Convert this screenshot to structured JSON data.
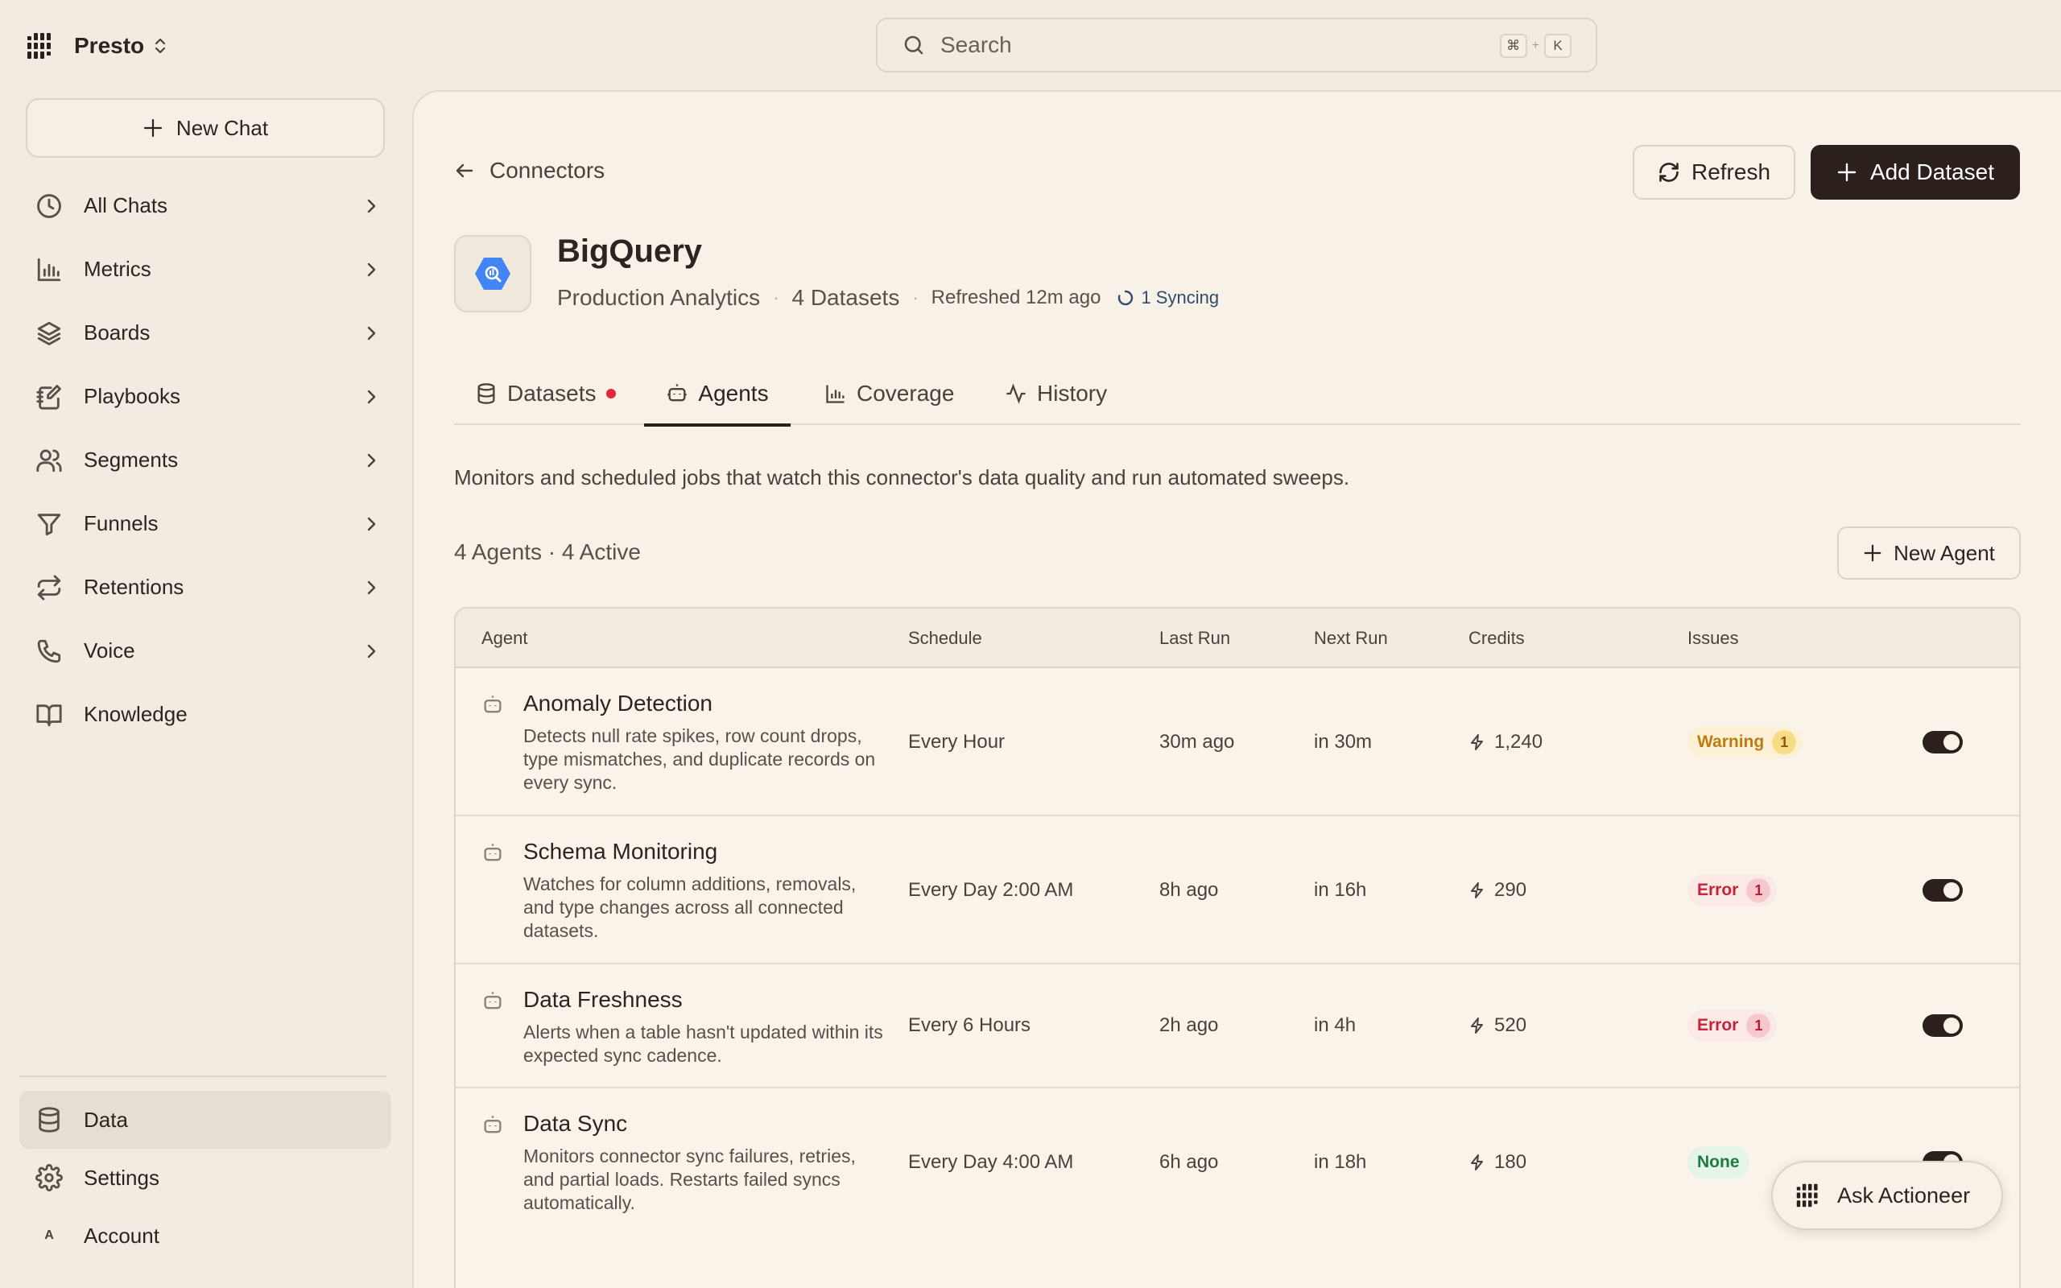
{
  "app": {
    "name": "Presto"
  },
  "sidebar": {
    "new_chat": "New Chat",
    "items": [
      {
        "label": "All Chats",
        "icon": "clock-icon"
      },
      {
        "label": "Metrics",
        "icon": "bar-chart-icon"
      },
      {
        "label": "Boards",
        "icon": "layers-icon"
      },
      {
        "label": "Playbooks",
        "icon": "notebook-pen-icon"
      },
      {
        "label": "Segments",
        "icon": "users-icon"
      },
      {
        "label": "Funnels",
        "icon": "funnel-icon"
      },
      {
        "label": "Retentions",
        "icon": "repeat-icon"
      },
      {
        "label": "Voice",
        "icon": "phone-icon"
      },
      {
        "label": "Knowledge",
        "icon": "book-open-icon"
      }
    ],
    "bottom": [
      {
        "label": "Data",
        "icon": "database-icon",
        "active": true
      },
      {
        "label": "Settings",
        "icon": "gear-icon"
      },
      {
        "label": "Account",
        "avatar": "A"
      }
    ]
  },
  "search": {
    "placeholder": "Search",
    "shortcut_cmd": "⌘",
    "shortcut_plus": "+",
    "shortcut_key": "K"
  },
  "header": {
    "back_label": "Connectors",
    "refresh_label": "Refresh",
    "add_label": "Add Dataset"
  },
  "connector": {
    "title": "BigQuery",
    "project": "Production Analytics",
    "sep": "·",
    "datasets": "4 Datasets",
    "refreshed": "Refreshed 12m ago",
    "syncing": "1 Syncing"
  },
  "tabs": [
    {
      "label": "Datasets",
      "icon": "database-icon",
      "has_dot": true
    },
    {
      "label": "Agents",
      "icon": "bot-icon",
      "active": true
    },
    {
      "label": "Coverage",
      "icon": "bar-chart-icon"
    },
    {
      "label": "History",
      "icon": "activity-icon"
    }
  ],
  "agents_section": {
    "description": "Monitors and scheduled jobs that watch this connector's data quality and run automated sweeps.",
    "count": "4 Agents · 4 Active",
    "new_agent_label": "New Agent"
  },
  "table": {
    "columns": [
      "Agent",
      "Schedule",
      "Last Run",
      "Next Run",
      "Credits",
      "Issues"
    ],
    "rows": [
      {
        "name": "Anomaly Detection",
        "description": "Detects null rate spikes, row count drops, type mismatches, and duplicate records on every sync.",
        "schedule": "Every Hour",
        "last_run": "30m ago",
        "next_run": "in 30m",
        "credits": "1,240",
        "issue_label": "Warning",
        "issue_count": "1",
        "issue_kind": "warn",
        "enabled": true
      },
      {
        "name": "Schema Monitoring",
        "description": "Watches for column additions, removals, and type changes across all connected datasets.",
        "schedule": "Every Day 2:00 AM",
        "last_run": "8h ago",
        "next_run": "in 16h",
        "credits": "290",
        "issue_label": "Error",
        "issue_count": "1",
        "issue_kind": "err",
        "enabled": true
      },
      {
        "name": "Data Freshness",
        "description": "Alerts when a table hasn't updated within its expected sync cadence.",
        "schedule": "Every 6 Hours",
        "last_run": "2h ago",
        "next_run": "in 4h",
        "credits": "520",
        "issue_label": "Error",
        "issue_count": "1",
        "issue_kind": "err",
        "enabled": true
      },
      {
        "name": "Data Sync",
        "description": "Monitors connector sync failures, retries, and partial loads. Restarts failed syncs automatically.",
        "schedule": "Every Day 4:00 AM",
        "last_run": "6h ago",
        "next_run": "in 18h",
        "credits": "180",
        "issue_label": "None",
        "issue_count": "",
        "issue_kind": "none",
        "enabled": true
      }
    ]
  },
  "ask_button": {
    "label": "Ask Actioneer"
  },
  "colors": {
    "background": "#f3ebe1",
    "panel": "#f8f1e8",
    "primary": "#2b201b",
    "error": "#c4233a",
    "warning": "#c07a12",
    "success": "#1f7a43",
    "sync": "#2f4d6b",
    "bigquery": "#4285f4"
  }
}
